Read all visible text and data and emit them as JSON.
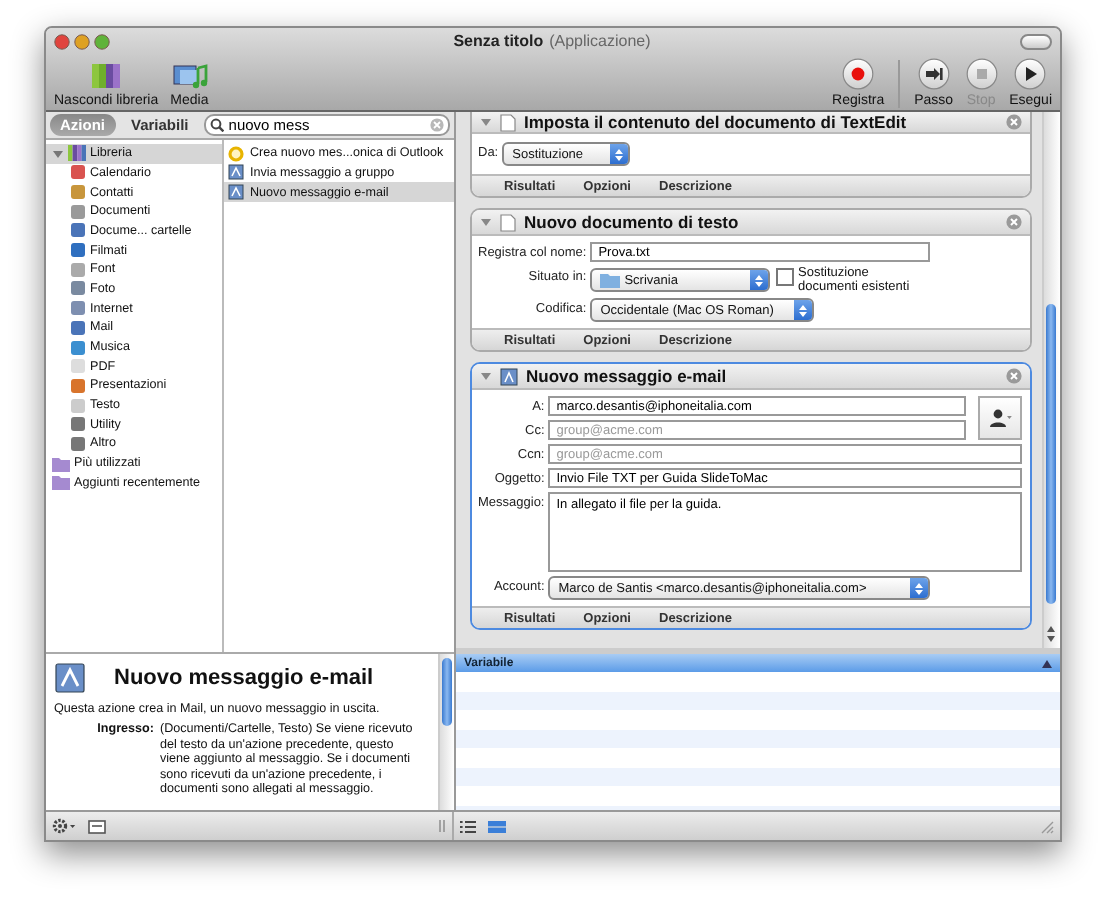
{
  "window": {
    "title": "Senza titolo",
    "subtitle": "(Applicazione)"
  },
  "toolbar": {
    "left": [
      {
        "label": "Nascondi libreria",
        "kind": "library"
      },
      {
        "label": "Media",
        "kind": "media"
      }
    ],
    "right": [
      {
        "label": "Registra",
        "kind": "record",
        "disabled": false
      },
      {
        "label": "Passo",
        "kind": "step",
        "disabled": false
      },
      {
        "label": "Stop",
        "kind": "stop",
        "disabled": true
      },
      {
        "label": "Esegui",
        "kind": "run",
        "disabled": false
      }
    ]
  },
  "library_tabs": [
    {
      "label": "Azioni",
      "selected": true
    },
    {
      "label": "Variabili",
      "selected": false
    }
  ],
  "search": {
    "value": "nuovo mess"
  },
  "library": [
    {
      "label": "Libreria",
      "kind": "library",
      "selected": true,
      "expanded": true,
      "children": [
        {
          "label": "Calendario",
          "selected": false
        },
        {
          "label": "Contatti",
          "selected": false
        },
        {
          "label": "Documenti",
          "selected": false
        },
        {
          "label": "Docume... cartelle",
          "selected": false
        },
        {
          "label": "Filmati",
          "selected": false
        },
        {
          "label": "Font",
          "selected": false
        },
        {
          "label": "Foto",
          "selected": false
        },
        {
          "label": "Internet",
          "selected": false
        },
        {
          "label": "Mail",
          "selected": false
        },
        {
          "label": "Musica",
          "selected": false
        },
        {
          "label": "PDF",
          "selected": false
        },
        {
          "label": "Presentazioni",
          "selected": false
        },
        {
          "label": "Testo",
          "selected": false
        },
        {
          "label": "Utility",
          "selected": false
        },
        {
          "label": "Altro",
          "selected": false
        }
      ]
    },
    {
      "label": "Più utilizzati",
      "kind": "smart",
      "selected": false
    },
    {
      "label": "Aggiunti recentemente",
      "kind": "smart",
      "selected": false
    }
  ],
  "actions": [
    {
      "label": "Crea nuovo mes...onica di Outlook",
      "kind": "outlook",
      "selected": false
    },
    {
      "label": "Invia messaggio a gruppo",
      "kind": "mail",
      "selected": false
    },
    {
      "label": "Nuovo messaggio e-mail",
      "kind": "mail",
      "selected": true
    }
  ],
  "workflow": [
    {
      "kind": "partial",
      "title": "Imposta il contenuto del documento di TextEdit",
      "selected": false,
      "fields": [
        {
          "kind": "popup",
          "label": "Da:",
          "value": "Sostituzione"
        }
      ],
      "footer": [
        "Risultati",
        "Opzioni",
        "Descrizione"
      ]
    },
    {
      "kind": "document",
      "title": "Nuovo documento di testo",
      "selected": false,
      "fields": [
        {
          "kind": "text",
          "label": "Registra col nome:",
          "value": "Prova.txt"
        },
        {
          "kind": "popup",
          "label": "Situato in:",
          "value": "Scrivania",
          "folder": true,
          "checkbox": {
            "label": "Sostituzione documenti esistenti",
            "checked": false
          }
        },
        {
          "kind": "popup",
          "label": "Codifica:",
          "value": "Occidentale (Mac OS Roman)"
        }
      ],
      "footer": [
        "Risultati",
        "Opzioni",
        "Descrizione"
      ]
    },
    {
      "kind": "mail",
      "title": "Nuovo messaggio e-mail",
      "selected": true,
      "fields": [
        {
          "kind": "text",
          "label": "A:",
          "value": "marco.desantis@iphoneitalia.com"
        },
        {
          "kind": "text",
          "label": "Cc:",
          "placeholder": "group@acme.com"
        },
        {
          "kind": "text",
          "label": "Ccn:",
          "placeholder": "group@acme.com"
        },
        {
          "kind": "text",
          "label": "Oggetto:",
          "value": "Invio File TXT per Guida SlideToMac"
        },
        {
          "kind": "textarea",
          "label": "Messaggio:",
          "value": "In allegato il file per la guida."
        },
        {
          "kind": "popup",
          "label": "Account:",
          "value": "Marco de Santis <marco.desantis@iphoneitalia.com>"
        }
      ],
      "footer": [
        "Risultati",
        "Opzioni",
        "Descrizione"
      ]
    }
  ],
  "description": {
    "title": "Nuovo messaggio e-mail",
    "summary": "Questa azione crea in Mail, un nuovo messaggio in uscita.",
    "fields": [
      {
        "label": "Ingresso:",
        "text": "(Documenti/Cartelle, Testo) Se viene ricevuto del testo da un'azione precedente, questo viene aggiunto al messaggio. Se i documenti sono ricevuti da un'azione precedente, i documenti sono allegati al messaggio."
      }
    ]
  },
  "variables": {
    "columns": [
      "Variabile"
    ]
  }
}
